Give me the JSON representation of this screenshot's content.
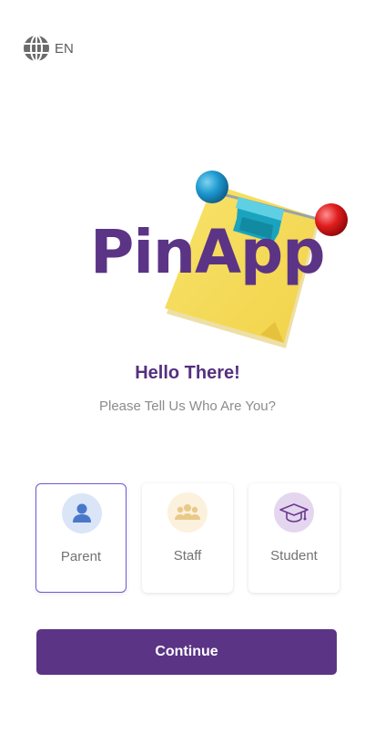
{
  "language": {
    "icon": "globe-icon",
    "code": "EN"
  },
  "brand": {
    "logo_text": "PinApp",
    "primary_color": "#5b3486"
  },
  "greeting": {
    "title": "Hello There!",
    "subtitle": "Please Tell Us Who Are You?"
  },
  "roles": [
    {
      "label": "Parent",
      "icon": "person-icon",
      "selected": true,
      "icon_bg": "#dbe5f8",
      "icon_color": "#4a78c9"
    },
    {
      "label": "Staff",
      "icon": "group-icon",
      "selected": false,
      "icon_bg": "#fbf1dc",
      "icon_color": "#e9c98a"
    },
    {
      "label": "Student",
      "icon": "graduation-cap-icon",
      "selected": false,
      "icon_bg": "#e5d6ef",
      "icon_color": "#6a3a8f"
    }
  ],
  "actions": {
    "continue_label": "Continue"
  }
}
